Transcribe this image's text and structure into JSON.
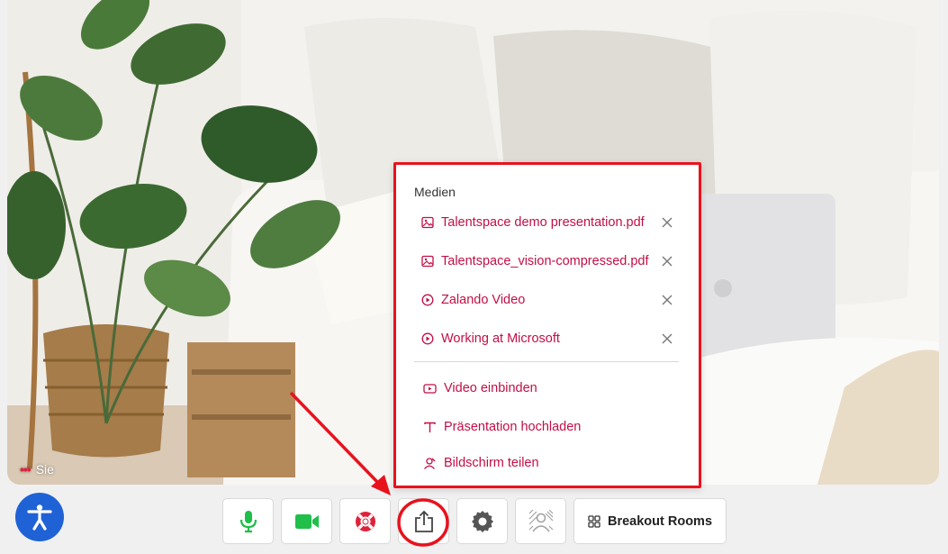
{
  "video": {
    "self_label": "Sie",
    "self_indicator": "•••"
  },
  "media_menu": {
    "heading": "Medien",
    "items": [
      {
        "label": "Talentspace demo presentation.pdf",
        "icon": "image-icon"
      },
      {
        "label": "Talentspace_vision-compressed.pdf",
        "icon": "image-icon"
      },
      {
        "label": "Zalando Video",
        "icon": "play-circle-icon"
      },
      {
        "label": "Working at Microsoft",
        "icon": "play-circle-icon"
      }
    ],
    "actions": [
      {
        "label": "Video einbinden",
        "icon": "video-embed-icon"
      },
      {
        "label": "Präsentation hochladen",
        "icon": "text-upload-icon"
      },
      {
        "label": "Bildschirm teilen",
        "icon": "screen-share-person-icon"
      }
    ]
  },
  "toolbar": {
    "breakout_label": "Breakout Rooms",
    "buttons": [
      "microphone-icon",
      "camera-icon",
      "lifebuoy-icon",
      "share-icon",
      "gear-icon",
      "background-blur-icon",
      "breakout-rooms-icon"
    ]
  },
  "colors": {
    "accent": "#c20f45",
    "annotation": "#e8121d",
    "mic_green": "#1fbf4a",
    "a11y_blue": "#1f62d6"
  }
}
